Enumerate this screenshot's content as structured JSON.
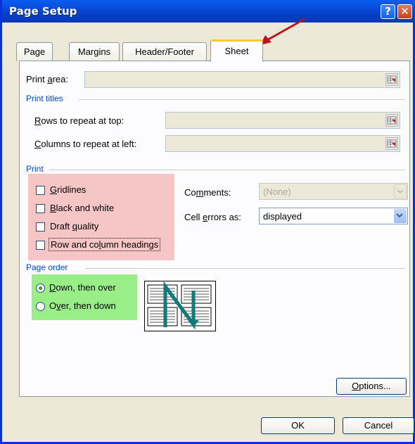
{
  "window": {
    "title": "Page Setup",
    "help_glyph": "?",
    "close_glyph": "✕"
  },
  "tabs": [
    {
      "label": "Page"
    },
    {
      "label": "Margins"
    },
    {
      "label": "Header/Footer"
    },
    {
      "label": "Sheet",
      "active": true
    }
  ],
  "print_area": {
    "label_pre": "Print ",
    "label_ul": "a",
    "label_post": "rea:",
    "value": ""
  },
  "print_titles": {
    "title": "Print titles",
    "rows": {
      "label_ul": "R",
      "label_post": "ows to repeat at top:",
      "value": ""
    },
    "columns": {
      "label_ul": "C",
      "label_post": "olumns to repeat at left:",
      "value": ""
    }
  },
  "print": {
    "title": "Print",
    "gridlines": {
      "label_ul": "G",
      "label_post": "ridlines",
      "checked": false
    },
    "black_white": {
      "label_ul": "B",
      "label_post": "lack and white",
      "checked": false
    },
    "draft_quality": {
      "label_pre": "Draft ",
      "label_ul": "q",
      "label_post": "uality",
      "checked": false
    },
    "headings": {
      "label_pre": "Row and co",
      "label_ul": "l",
      "label_post": "umn headings",
      "checked": false
    },
    "comments": {
      "label_pre": "Co",
      "label_ul": "m",
      "label_post": "ments:",
      "value": "(None)"
    },
    "cell_errors": {
      "label_pre": "Cell ",
      "label_ul": "e",
      "label_post": "rrors as:",
      "value": "displayed"
    }
  },
  "page_order": {
    "title": "Page order",
    "down_over": {
      "label_ul": "D",
      "label_post": "own, then over",
      "selected": true
    },
    "over_down": {
      "label_pre": "O",
      "label_ul": "v",
      "label_post": "er, then down",
      "selected": false
    }
  },
  "buttons": {
    "options": {
      "label_ul": "O",
      "label_post": "ptions..."
    },
    "ok": "OK",
    "cancel": "Cancel"
  },
  "colors": {
    "highlight_print": "#f6c6c6",
    "highlight_page_order": "#99ee88",
    "annotation_arrow": "#c0141c",
    "section_title": "#0046d5"
  }
}
